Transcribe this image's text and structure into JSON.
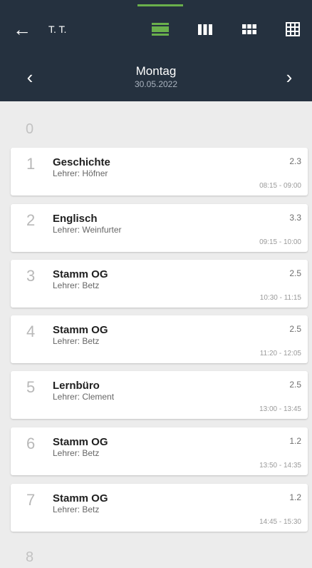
{
  "header": {
    "user": "T. T.",
    "view_icons": [
      "day-view-icon",
      "week-columns-icon",
      "small-grid-icon",
      "large-grid-icon"
    ],
    "day_name": "Montag",
    "date": "30.05.2022",
    "colors": {
      "header_bg": "#25313f",
      "accent": "#6ab04c"
    }
  },
  "slots": {
    "first_empty": "0",
    "last_empty": "8"
  },
  "lessons": [
    {
      "number": "1",
      "subject": "Geschichte",
      "teacher": "Lehrer: Höfner",
      "room": "2.3",
      "time": "08:15 - 09:00"
    },
    {
      "number": "2",
      "subject": "Englisch",
      "teacher": "Lehrer: Weinfurter",
      "room": "3.3",
      "time": "09:15 - 10:00"
    },
    {
      "number": "3",
      "subject": "Stamm OG",
      "teacher": "Lehrer: Betz",
      "room": "2.5",
      "time": "10:30 - 11:15"
    },
    {
      "number": "4",
      "subject": "Stamm OG",
      "teacher": "Lehrer: Betz",
      "room": "2.5",
      "time": "11:20 - 12:05"
    },
    {
      "number": "5",
      "subject": "Lernbüro",
      "teacher": "Lehrer: Clement",
      "room": "2.5",
      "time": "13:00 - 13:45"
    },
    {
      "number": "6",
      "subject": "Stamm OG",
      "teacher": "Lehrer: Betz",
      "room": "1.2",
      "time": "13:50 - 14:35"
    },
    {
      "number": "7",
      "subject": "Stamm OG",
      "teacher": "Lehrer: Betz",
      "room": "1.2",
      "time": "14:45 - 15:30"
    }
  ]
}
